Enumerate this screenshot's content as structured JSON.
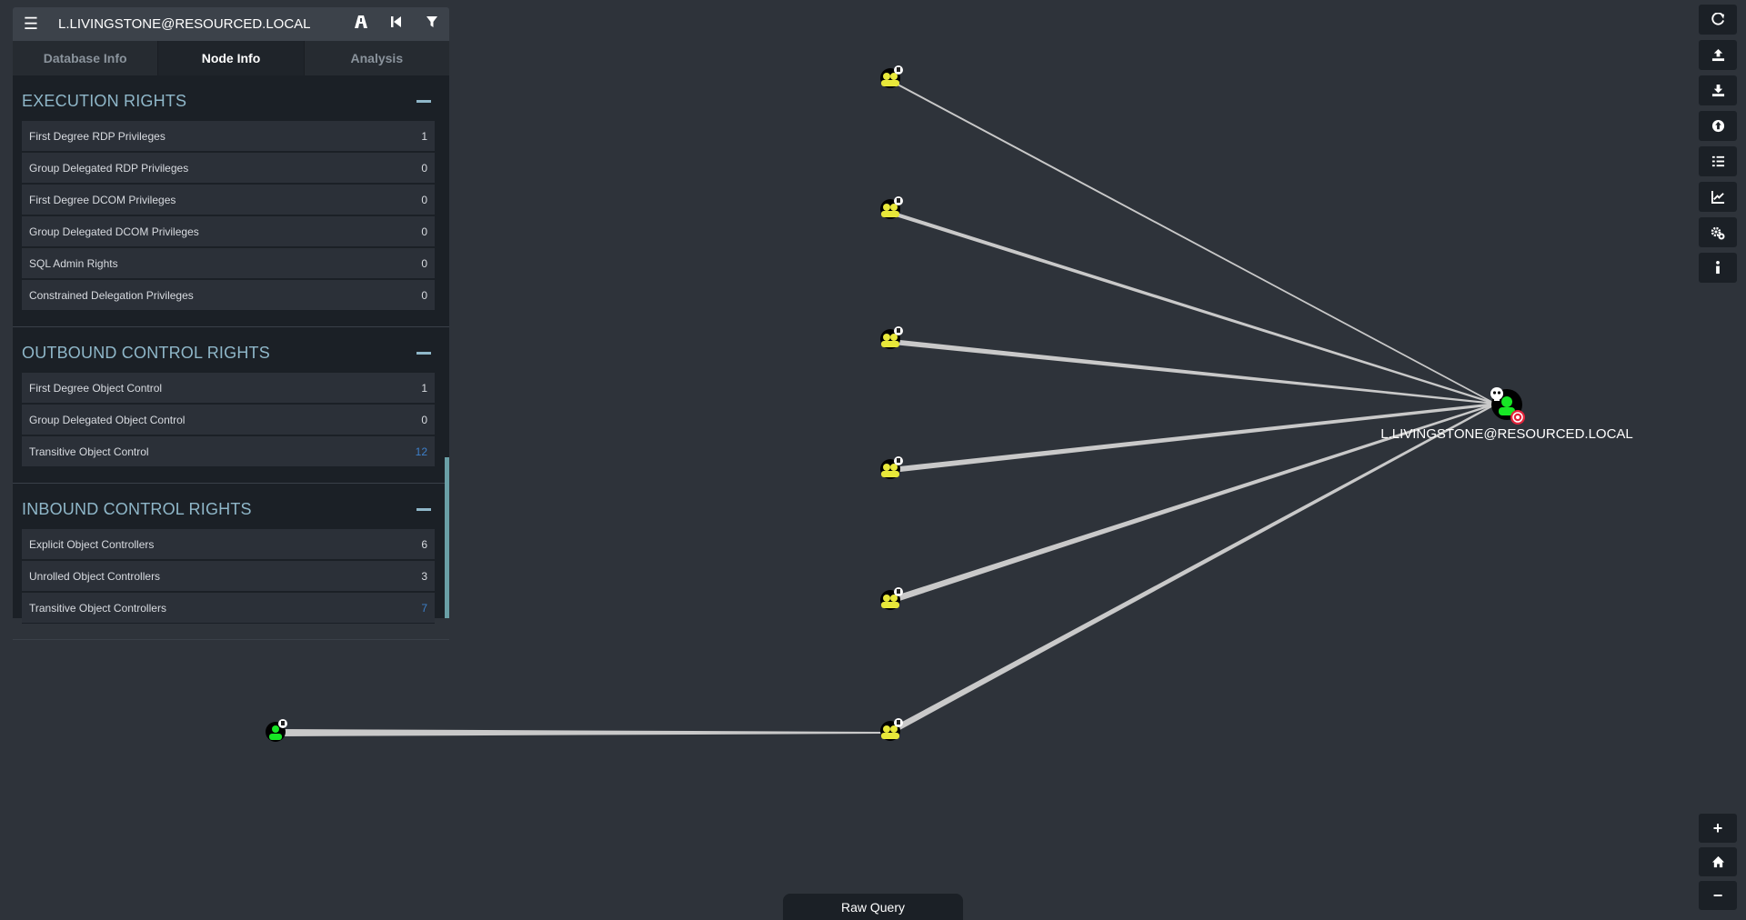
{
  "header": {
    "title": "L.LIVINGSTONE@RESOURCED.LOCAL",
    "icons": [
      "hamburger-icon",
      "pathfinding-icon",
      "back-icon",
      "filter-icon"
    ]
  },
  "tabs": [
    {
      "label": "Database Info",
      "active": false
    },
    {
      "label": "Node Info",
      "active": true
    },
    {
      "label": "Analysis",
      "active": false
    }
  ],
  "sections": {
    "execution": {
      "title": "EXECUTION RIGHTS",
      "rows": [
        {
          "label": "First Degree RDP Privileges",
          "value": "1"
        },
        {
          "label": "Group Delegated RDP Privileges",
          "value": "0"
        },
        {
          "label": "First Degree DCOM Privileges",
          "value": "0"
        },
        {
          "label": "Group Delegated DCOM Privileges",
          "value": "0"
        },
        {
          "label": "SQL Admin Rights",
          "value": "0"
        },
        {
          "label": "Constrained Delegation Privileges",
          "value": "0"
        }
      ]
    },
    "outbound": {
      "title": "OUTBOUND CONTROL RIGHTS",
      "rows": [
        {
          "label": "First Degree Object Control",
          "value": "1"
        },
        {
          "label": "Group Delegated Object Control",
          "value": "0"
        },
        {
          "label": "Transitive Object Control",
          "value": "12"
        }
      ]
    },
    "inbound": {
      "title": "INBOUND CONTROL RIGHTS",
      "rows": [
        {
          "label": "Explicit Object Controllers",
          "value": "6"
        },
        {
          "label": "Unrolled Object Controllers",
          "value": "3"
        },
        {
          "label": "Transitive Object Controllers",
          "value": "7"
        }
      ]
    }
  },
  "graph": {
    "target_label": "L.LIVINGSTONE@RESOURCED.LOCAL",
    "group_color": "#e8e83a",
    "user_color": "#17e625",
    "edge_color": "#c9c9c9",
    "target_badge_color": "#e3243b"
  },
  "toolbar": {
    "right_icons": [
      "refresh-icon",
      "upload-icon",
      "download-icon",
      "import-icon",
      "queries-icon",
      "chart-icon",
      "settings-icon",
      "info-icon"
    ],
    "zoom": {
      "plus": "+",
      "minus": "−",
      "home_icon": "home-icon"
    }
  },
  "raw_query": {
    "label": "Raw Query"
  }
}
